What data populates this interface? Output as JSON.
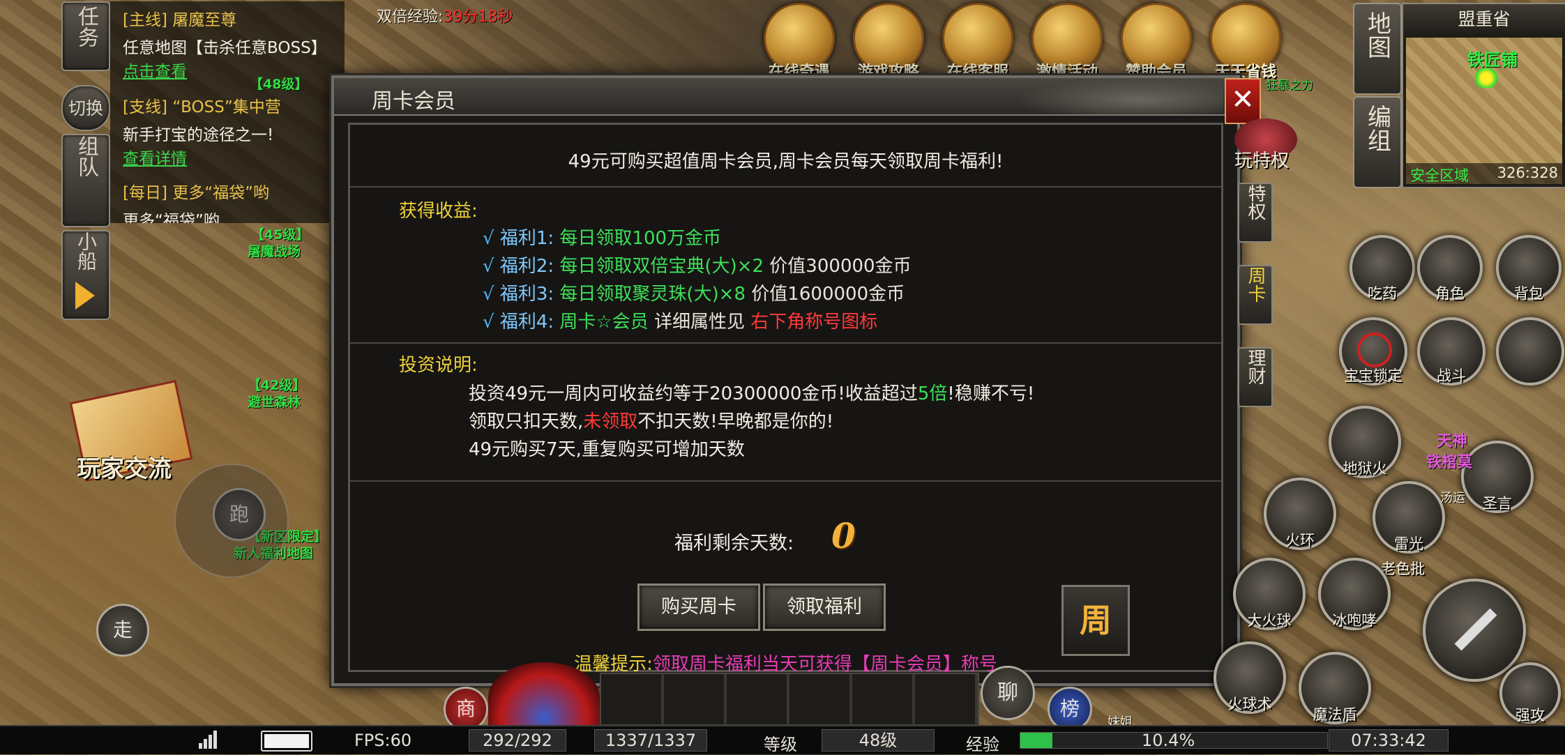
{
  "quest_panel": {
    "tabs": [
      "任务",
      "切换",
      "组队",
      "小船"
    ],
    "quests": [
      {
        "head": "[主线] 屠魔至尊",
        "text": "任意地图【击杀任意BOSS】",
        "link": "点击查看"
      },
      {
        "head": "[支线] “BOSS”集中营",
        "text": "新手打宝的途径之一!",
        "link": "查看详情"
      },
      {
        "head": "[每日] 更多“福袋”哟",
        "text": "更多“福袋”哟"
      }
    ],
    "level_labels": [
      "【48级】",
      "【45级】",
      "屠魔战场",
      "【42级】",
      "避世森林",
      "【新区限定】",
      "新人福利地图"
    ]
  },
  "top_bar": {
    "double_exp_label": "双倍经验:",
    "double_exp_time": "39分18秒",
    "icons": [
      "在线奇遇",
      "游戏攻略",
      "在线客服",
      "激情活动",
      "赞助会员",
      "天天省钱"
    ],
    "icon_names": [
      "lantern-icon",
      "strategy-icon",
      "service-icon",
      "event-icon",
      "member-icon",
      "savings-icon"
    ],
    "tiny_label": "狂暴之力"
  },
  "minimap": {
    "buttons": [
      "地图",
      "编组"
    ],
    "region": "盟重省",
    "place": "铁匠铺",
    "zone": "安全区域",
    "coords": "326:328"
  },
  "dialog": {
    "title": "周卡会员",
    "headline": "49元可购买超值周卡会员,周卡会员每天领取周卡福利!",
    "benefits_label": "获得收益:",
    "benefits": [
      {
        "check": "√",
        "name": "福利1:",
        "desc": "每日领取100万金币",
        "extra": ""
      },
      {
        "check": "√",
        "name": "福利2:",
        "desc": "每日领取双倍宝典(大)×2",
        "extra": " 价值300000金币"
      },
      {
        "check": "√",
        "name": "福利3:",
        "desc": "每日领取聚灵珠(大)×8",
        "extra": " 价值1600000金币"
      },
      {
        "check": "√",
        "name": "福利4:",
        "desc": "周卡☆会员",
        "extra": " 详细属性见 ",
        "red": "右下角称号图标"
      }
    ],
    "invest_label": "投资说明:",
    "invest_lines": [
      {
        "a": "投资49元一周内可收益约等于20300000金币!收益超过",
        "g": "5倍",
        "b": "!稳赚不亏!"
      },
      {
        "a": "领取只扣天数,",
        "r": "未领取",
        "b": "不扣天数!早晚都是你的!"
      },
      {
        "a": "49元购买7天,重复购买可增加天数"
      }
    ],
    "remaining_label": "福利剩余天数:",
    "remaining_days": "0",
    "buy_button": "购买周卡",
    "claim_button": "领取福利",
    "week_icon": "周",
    "tip_label": "温馨提示:",
    "tip_text": "领取周卡福利当天可获得【周卡会员】称号",
    "side_tabs": [
      "特权",
      "周卡",
      "理财"
    ],
    "top_right_label": "玩特权"
  },
  "skills": {
    "row1": [
      "吃药",
      "角色",
      "背包"
    ],
    "row2": [
      "宝宝锁定",
      "战斗"
    ],
    "others": [
      "地狱火",
      "圣言",
      "火环",
      "雷光",
      "老色批",
      "大火球",
      "冰咆哮",
      "火球术",
      "魔法盾"
    ],
    "bottom_right": "强攻",
    "overlay": [
      "天神",
      "铁棺莫",
      "汤运"
    ]
  },
  "left_controls": {
    "trade": "玩家交流",
    "run": "跑",
    "walk": "走"
  },
  "bottom_controls": {
    "shop": "商",
    "chat": "聊",
    "rank": "榜",
    "npc": "妹姐"
  },
  "status_bar": {
    "fps": "FPS:60",
    "hp": "292/292",
    "mp": "1337/1337",
    "level_label": "等级",
    "level": "48级",
    "exp_label": "经验",
    "exp": "10.4%",
    "exp_fraction": 0.104,
    "time": "07:33:42"
  },
  "colors": {
    "gold": "#f0d23a",
    "green": "#3de05a",
    "red": "#ff3a3a",
    "magenta": "#e83cb8",
    "blue": "#7ec9ff"
  }
}
